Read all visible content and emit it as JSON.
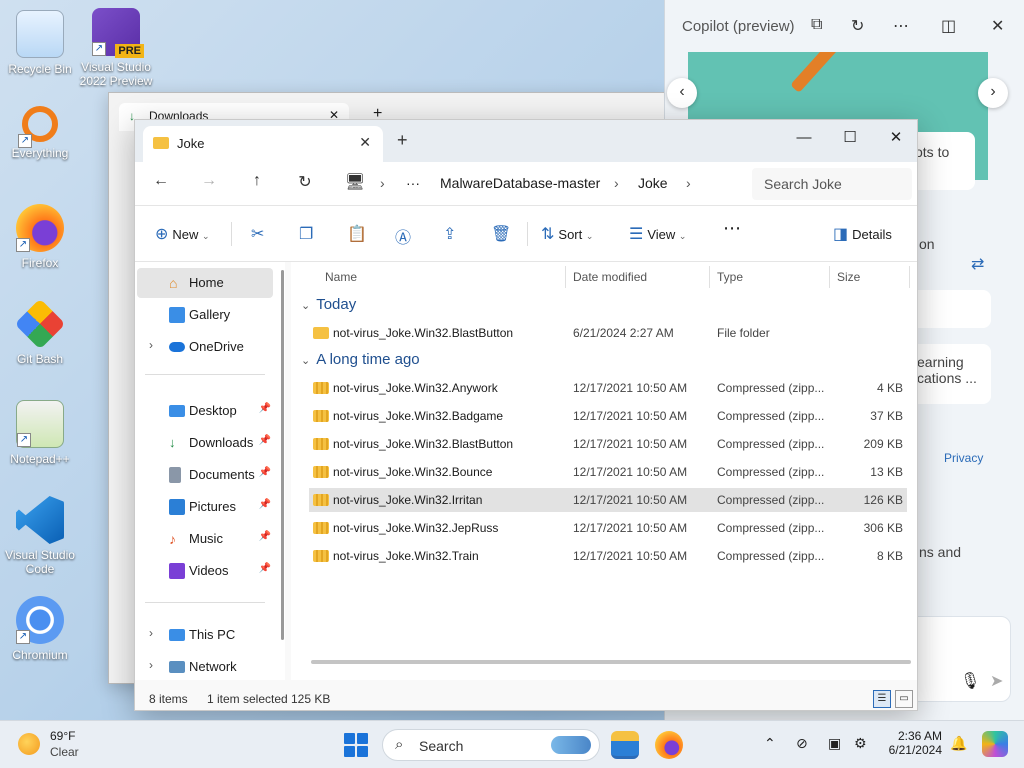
{
  "desktop": {
    "icons": [
      {
        "label": "Recycle Bin"
      },
      {
        "label": "Visual Studio 2022 Preview",
        "badge": "PRE"
      },
      {
        "label": "Everything"
      },
      {
        "label": "Firefox"
      },
      {
        "label": "Git Bash"
      },
      {
        "label": "Notepad++"
      },
      {
        "label": "Visual Studio Code"
      },
      {
        "label": "Chromium"
      }
    ]
  },
  "bg_window": {
    "tab_label": "Downloads"
  },
  "copilot": {
    "title": "Copilot (preview)",
    "card1": "ots to",
    "text1": "on",
    "card2_line1": "earning",
    "card2_line2": "cations ...",
    "privacy": "Privacy",
    "text2": "ns and"
  },
  "explorer": {
    "tab_label": "Joke",
    "breadcrumbs": [
      "MalwareDatabase-master",
      "Joke"
    ],
    "search_placeholder": "Search Joke",
    "toolbar": {
      "new": "New",
      "sort": "Sort",
      "view": "View",
      "details": "Details"
    },
    "sidebar": {
      "home": "Home",
      "gallery": "Gallery",
      "onedrive": "OneDrive",
      "desktop": "Desktop",
      "downloads": "Downloads",
      "documents": "Documents",
      "pictures": "Pictures",
      "music": "Music",
      "videos": "Videos",
      "thispc": "This PC",
      "network": "Network"
    },
    "columns": {
      "name": "Name",
      "date": "Date modified",
      "type": "Type",
      "size": "Size"
    },
    "groups": {
      "today": "Today",
      "long_ago": "A long time ago"
    },
    "files_today": [
      {
        "name": "not-virus_Joke.Win32.BlastButton",
        "date": "6/21/2024 2:27 AM",
        "type": "File folder",
        "size": ""
      }
    ],
    "files_old": [
      {
        "name": "not-virus_Joke.Win32.Anywork",
        "date": "12/17/2021 10:50 AM",
        "type": "Compressed (zipp...",
        "size": "4 KB"
      },
      {
        "name": "not-virus_Joke.Win32.Badgame",
        "date": "12/17/2021 10:50 AM",
        "type": "Compressed (zipp...",
        "size": "37 KB"
      },
      {
        "name": "not-virus_Joke.Win32.BlastButton",
        "date": "12/17/2021 10:50 AM",
        "type": "Compressed (zipp...",
        "size": "209 KB"
      },
      {
        "name": "not-virus_Joke.Win32.Bounce",
        "date": "12/17/2021 10:50 AM",
        "type": "Compressed (zipp...",
        "size": "13 KB"
      },
      {
        "name": "not-virus_Joke.Win32.Irritan",
        "date": "12/17/2021 10:50 AM",
        "type": "Compressed (zipp...",
        "size": "126 KB"
      },
      {
        "name": "not-virus_Joke.Win32.JepRuss",
        "date": "12/17/2021 10:50 AM",
        "type": "Compressed (zipp...",
        "size": "306 KB"
      },
      {
        "name": "not-virus_Joke.Win32.Train",
        "date": "12/17/2021 10:50 AM",
        "type": "Compressed (zipp...",
        "size": "8 KB"
      }
    ],
    "status": {
      "items": "8 items",
      "selected": "1 item selected",
      "size": "125 KB"
    }
  },
  "taskbar": {
    "temp": "69°F",
    "condition": "Clear",
    "search": "Search",
    "time": "2:36 AM",
    "date": "6/21/2024"
  }
}
